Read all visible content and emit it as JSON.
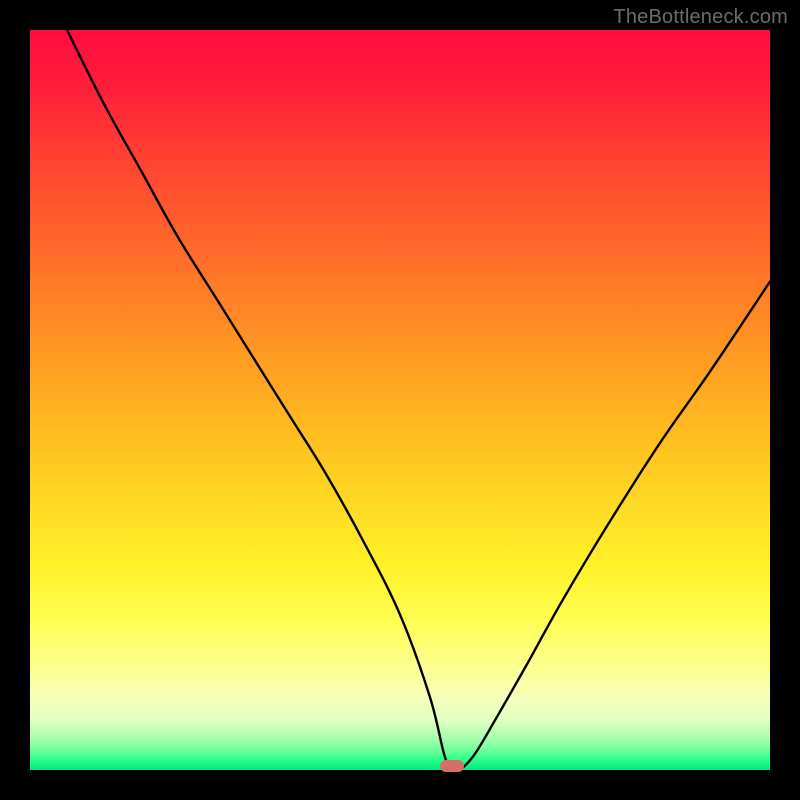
{
  "watermark": "TheBottleneck.com",
  "chart_data": {
    "type": "line",
    "title": "",
    "xlabel": "",
    "ylabel": "",
    "x_range": [
      0,
      100
    ],
    "y_range": [
      0,
      100
    ],
    "grid": false,
    "legend": false,
    "annotations": [],
    "marker": {
      "x": 57,
      "y": 0,
      "color": "#d86e68"
    },
    "series": [
      {
        "name": "curve",
        "x": [
          5,
          10,
          15,
          20,
          25,
          30,
          35,
          40,
          45,
          50,
          54,
          56,
          57,
          58,
          60,
          63,
          67,
          72,
          78,
          85,
          92,
          100
        ],
        "y": [
          100,
          90,
          81,
          72,
          64,
          56,
          48,
          40,
          31,
          21,
          10,
          2,
          0,
          0,
          2,
          7,
          14,
          23,
          33,
          44,
          54,
          66
        ]
      }
    ],
    "background_gradient": {
      "type": "vertical",
      "stops": [
        {
          "pos": 0.0,
          "color": "#ff0b3f"
        },
        {
          "pos": 0.3,
          "color": "#ff6b2a"
        },
        {
          "pos": 0.6,
          "color": "#ffd924"
        },
        {
          "pos": 0.82,
          "color": "#ffff53"
        },
        {
          "pos": 0.95,
          "color": "#b9ffb1"
        },
        {
          "pos": 1.0,
          "color": "#00e97a"
        }
      ]
    }
  }
}
